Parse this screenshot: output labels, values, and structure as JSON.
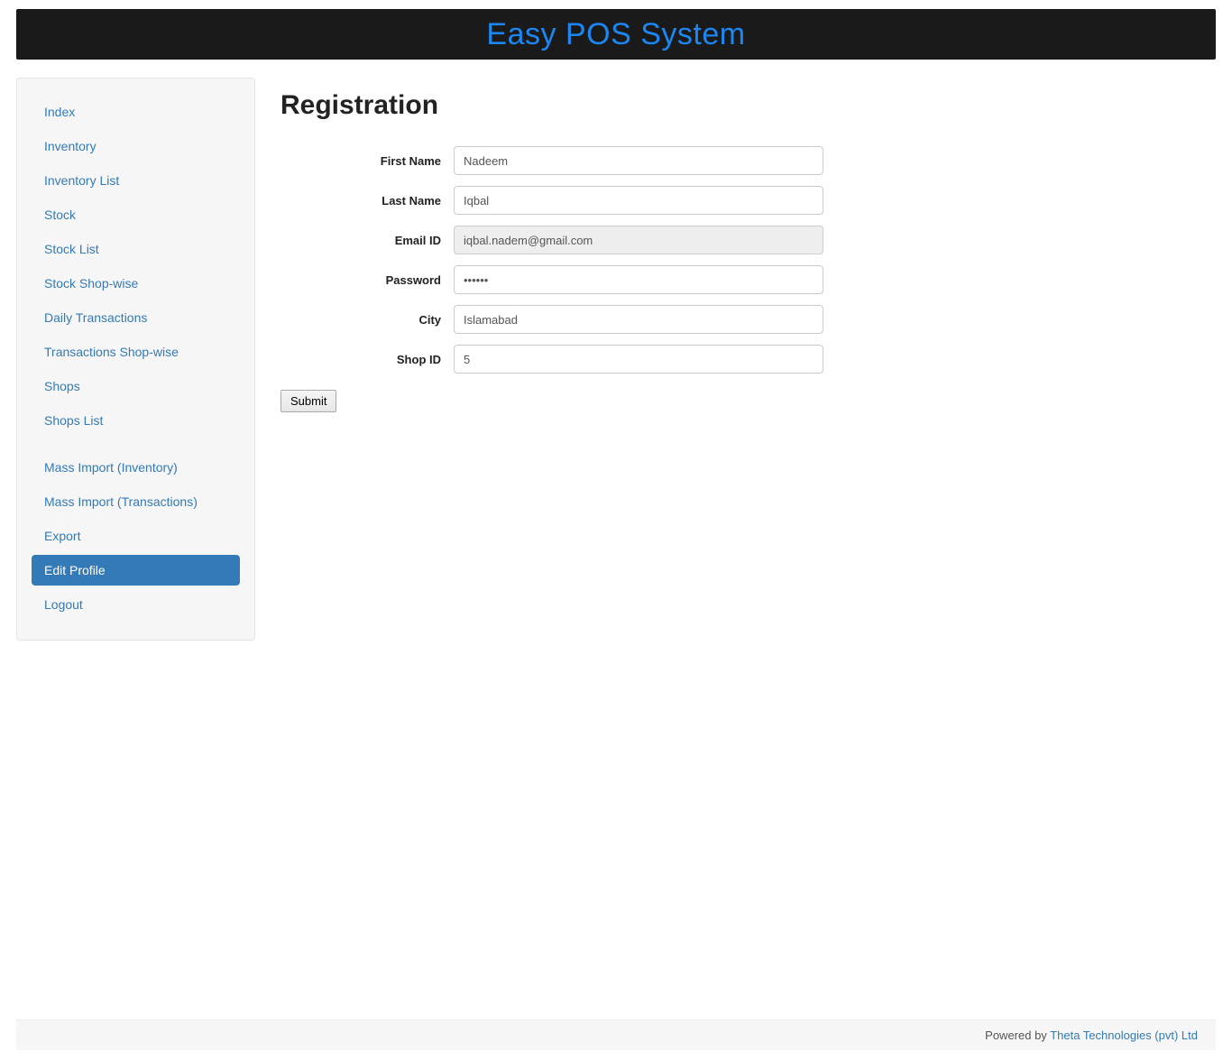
{
  "header": {
    "title": "Easy POS System"
  },
  "sidebar": {
    "items": [
      {
        "label": "Index",
        "active": false
      },
      {
        "label": "Inventory",
        "active": false
      },
      {
        "label": "Inventory List",
        "active": false
      },
      {
        "label": "Stock",
        "active": false
      },
      {
        "label": "Stock List",
        "active": false
      },
      {
        "label": "Stock Shop-wise",
        "active": false
      },
      {
        "label": "Daily Transactions",
        "active": false
      },
      {
        "label": "Transactions Shop-wise",
        "active": false
      },
      {
        "label": "Shops",
        "active": false
      },
      {
        "label": "Shops List",
        "active": false
      }
    ],
    "items2": [
      {
        "label": "Mass Import (Inventory)",
        "active": false
      },
      {
        "label": "Mass Import (Transactions)",
        "active": false
      },
      {
        "label": "Export",
        "active": false
      },
      {
        "label": "Edit Profile",
        "active": true
      },
      {
        "label": "Logout",
        "active": false
      }
    ]
  },
  "main": {
    "title": "Registration",
    "fields": {
      "first_name": {
        "label": "First Name",
        "value": "Nadeem"
      },
      "last_name": {
        "label": "Last Name",
        "value": "Iqbal"
      },
      "email": {
        "label": "Email ID",
        "value": "iqbal.nadem@gmail.com"
      },
      "password": {
        "label": "Password",
        "value": "••••••"
      },
      "city": {
        "label": "City",
        "value": "Islamabad"
      },
      "shop_id": {
        "label": "Shop ID",
        "value": "5"
      }
    },
    "submit_label": "Submit"
  },
  "footer": {
    "powered_by": "Powered by ",
    "company": "Theta Technologies (pvt) Ltd"
  }
}
